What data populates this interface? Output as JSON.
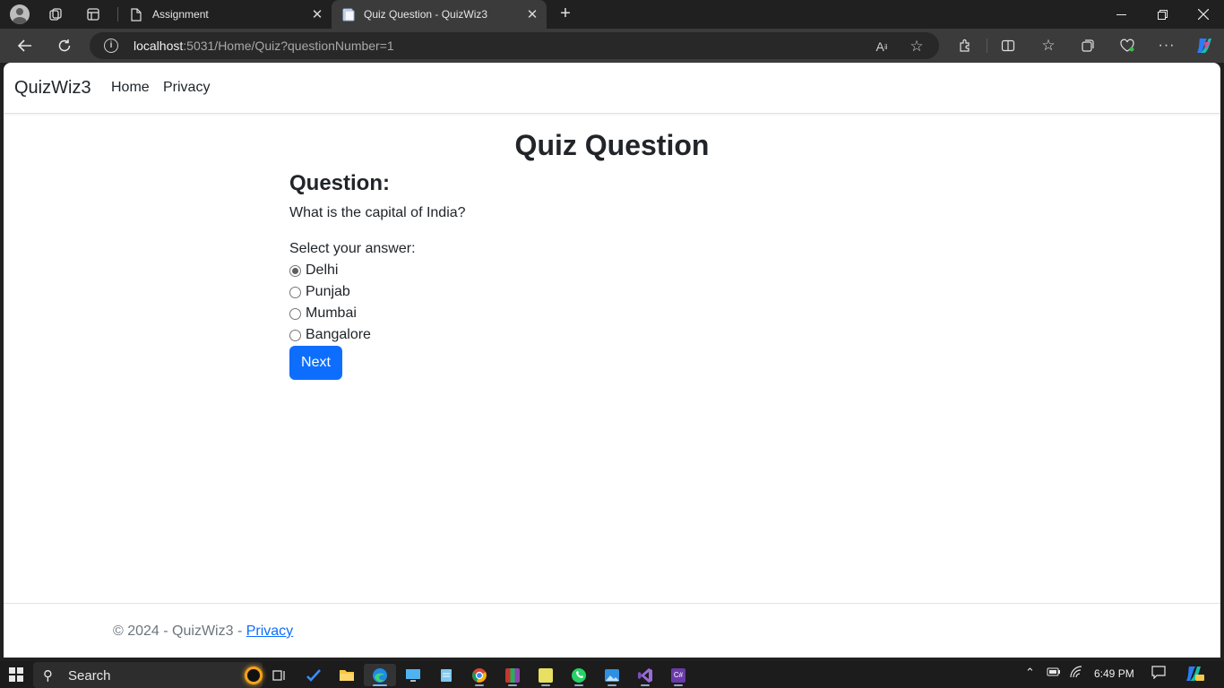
{
  "browser": {
    "tabs": [
      {
        "title": "Assignment",
        "active": false
      },
      {
        "title": "Quiz Question - QuizWiz3",
        "active": true
      }
    ],
    "address": {
      "host": "localhost",
      "path": ":5031/Home/Quiz?questionNumber=1"
    }
  },
  "site": {
    "brand": "QuizWiz3",
    "nav": [
      "Home",
      "Privacy"
    ]
  },
  "page": {
    "title": "Quiz Question",
    "question_heading": "Question:",
    "question_text": "What is the capital of India?",
    "select_label": "Select your answer:",
    "options": [
      {
        "label": "Delhi",
        "checked": true
      },
      {
        "label": "Punjab",
        "checked": false
      },
      {
        "label": "Mumbai",
        "checked": false
      },
      {
        "label": "Bangalore",
        "checked": false
      }
    ],
    "next_label": "Next"
  },
  "footer": {
    "text": "© 2024 - QuizWiz3 - ",
    "link": "Privacy"
  },
  "taskbar": {
    "search_label": "Search",
    "time": "6:49 PM"
  },
  "colors": {
    "primary": "#0d6efd",
    "browser_frame": "#202020",
    "taskbar": "#1c1c1c"
  }
}
